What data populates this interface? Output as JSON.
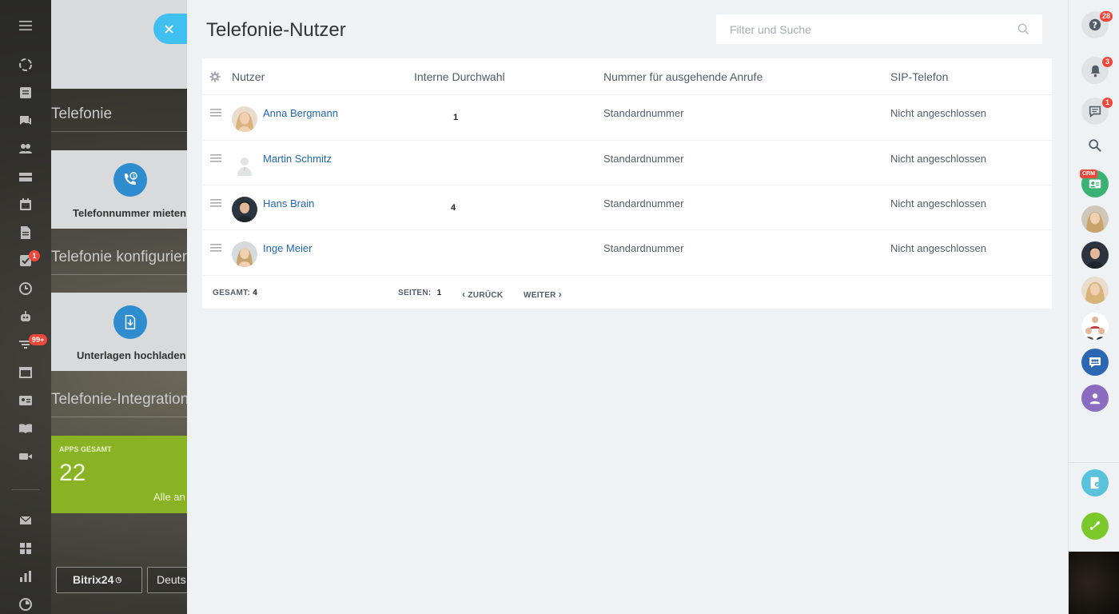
{
  "panel": {
    "title": "Telefonie-Nutzer",
    "search_placeholder": "Filter und Suche"
  },
  "table": {
    "headers": {
      "user": "Nutzer",
      "extension": "Interne Durchwahl",
      "outgoing": "Nummer für ausgehende Anrufe",
      "sip": "SIP-Telefon"
    },
    "rows": [
      {
        "name": "Anna Bergmann",
        "extension": "1",
        "outgoing": "Standardnummer",
        "sip": "Nicht angeschlossen"
      },
      {
        "name": "Martin Schmitz",
        "extension": "",
        "outgoing": "Standardnummer",
        "sip": "Nicht angeschlossen"
      },
      {
        "name": "Hans Brain",
        "extension": "4",
        "outgoing": "Standardnummer",
        "sip": "Nicht angeschlossen"
      },
      {
        "name": "Inge Meier",
        "extension": "",
        "outgoing": "Standardnummer",
        "sip": "Nicht angeschlossen"
      }
    ],
    "footer": {
      "total_label": "GESAMT:",
      "total_value": "4",
      "pages_label": "SEITEN:",
      "pages_value": "1",
      "prev_label": "ZURÜCK",
      "next_label": "WEITER"
    }
  },
  "background": {
    "section_telefonie": "Telefonie",
    "card_rent_label": "Telefonnummer mieten",
    "section_configure": "Telefonie konfigurieren",
    "card_upload_label": "Unterlagen hochladen",
    "section_integration": "Telefonie-Integration",
    "apps_caption": "APPS GESAMT",
    "apps_count": "22",
    "apps_all_link": "Alle an",
    "bitrix_button": "Bitrix24",
    "language_button": "Deuts"
  },
  "left_rail": {
    "tasks_badge": "1",
    "filter_badge": "99+"
  },
  "right_rail": {
    "help_badge": "28",
    "notifications_badge": "3",
    "messages_badge": "1",
    "crm_tag": "CRM"
  },
  "colors": {
    "link": "#2067b0",
    "accent_close": "#3fc0f0",
    "apps_tile": "#89b324",
    "badge": "#f0473c",
    "call_button": "#7ac82a"
  }
}
